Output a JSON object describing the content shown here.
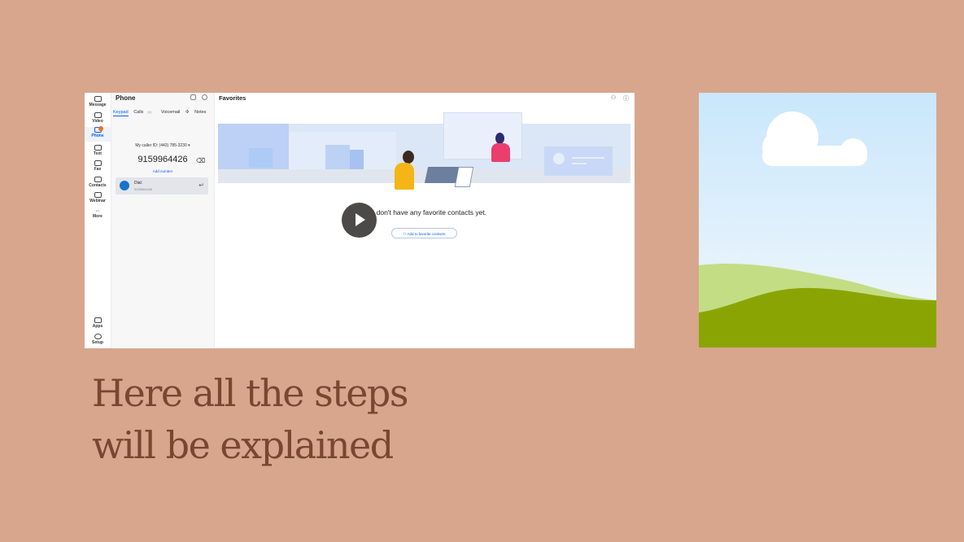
{
  "sidebar": {
    "items": [
      {
        "label": "Message",
        "icon": "message-icon"
      },
      {
        "label": "Video",
        "icon": "video-icon"
      },
      {
        "label": "Phone",
        "icon": "phone-icon",
        "active": true
      },
      {
        "label": "Text",
        "icon": "chat-bubble-icon"
      },
      {
        "label": "Fax",
        "icon": "fax-icon"
      },
      {
        "label": "Contacts",
        "icon": "contacts-icon"
      },
      {
        "label": "Webinar",
        "icon": "webinar-icon"
      },
      {
        "label": "More",
        "icon": "more-icon"
      }
    ],
    "bottom_items": [
      {
        "label": "Apps",
        "icon": "apps-icon"
      },
      {
        "label": "Setup",
        "icon": "setup-icon"
      }
    ]
  },
  "phone_panel": {
    "title": "Phone",
    "tabs": [
      "Keypad",
      "Calls",
      "Voicemail",
      "Notes"
    ],
    "calls_count": "(1)",
    "caller_id": "My caller ID: (443) 785-3230",
    "number": "9159964426",
    "add_number": "Add number",
    "dial": {
      "label": "Dial:",
      "number": "9159964426"
    }
  },
  "main": {
    "title": "Favorites",
    "empty_message": "You don't have any favorite contacts yet.",
    "add_button": "Add to favorite contacts"
  },
  "slide": {
    "heading_line1": "Here all the steps",
    "heading_line2": "will be explained"
  },
  "colors": {
    "background": "#d7a68d",
    "heading": "#7a4630",
    "accent": "#0b5cff",
    "play_button": "#4c4a49"
  }
}
